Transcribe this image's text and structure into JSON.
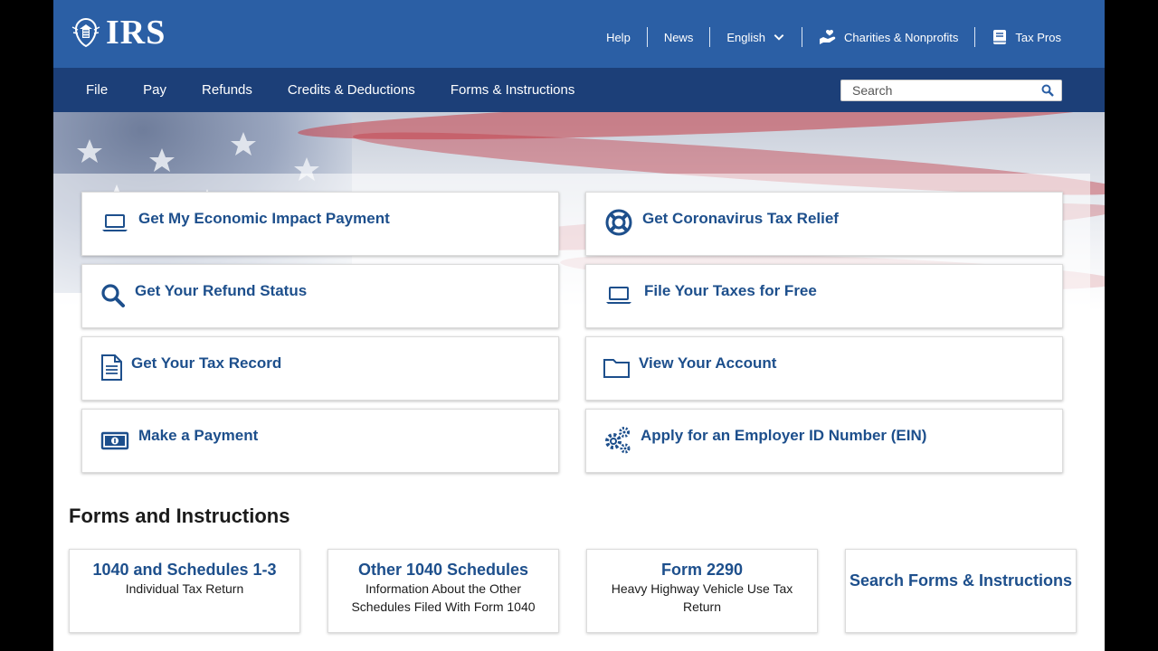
{
  "header": {
    "logo_text": "IRS",
    "util_links": [
      {
        "label": "Help"
      },
      {
        "label": "News"
      },
      {
        "label": "English"
      },
      {
        "label": "Charities & Nonprofits"
      },
      {
        "label": "Tax Pros"
      }
    ]
  },
  "nav": {
    "items": [
      {
        "label": "File"
      },
      {
        "label": "Pay"
      },
      {
        "label": "Refunds"
      },
      {
        "label": "Credits & Deductions"
      },
      {
        "label": "Forms & Instructions"
      }
    ],
    "search_placeholder": "Search"
  },
  "tiles": [
    {
      "label": "Get My Economic Impact Payment",
      "icon": "laptop-icon"
    },
    {
      "label": "Get Coronavirus Tax Relief",
      "icon": "lifebuoy-icon"
    },
    {
      "label": "Get Your Refund Status",
      "icon": "search-icon"
    },
    {
      "label": "File Your Taxes for Free",
      "icon": "laptop-icon"
    },
    {
      "label": "Get Your Tax Record",
      "icon": "document-icon"
    },
    {
      "label": "View Your Account",
      "icon": "folder-icon"
    },
    {
      "label": "Make a Payment",
      "icon": "money-icon"
    },
    {
      "label": "Apply for an Employer ID Number (EIN)",
      "icon": "gears-icon"
    }
  ],
  "forms": {
    "title": "Forms and Instructions",
    "cards": [
      {
        "title": "1040 and Schedules 1-3",
        "subtitle": "Individual Tax Return"
      },
      {
        "title": "Other 1040 Schedules",
        "subtitle": "Information About the Other Schedules Filed With Form 1040"
      },
      {
        "title": "Form 2290",
        "subtitle": "Heavy Highway Vehicle Use Tax Return"
      },
      {
        "title": "Search Forms & Instructions",
        "subtitle": ""
      }
    ]
  },
  "colors": {
    "header_blue": "#2b5fa5",
    "nav_navy": "#1c3f78",
    "link_blue": "#1d4f8c"
  }
}
